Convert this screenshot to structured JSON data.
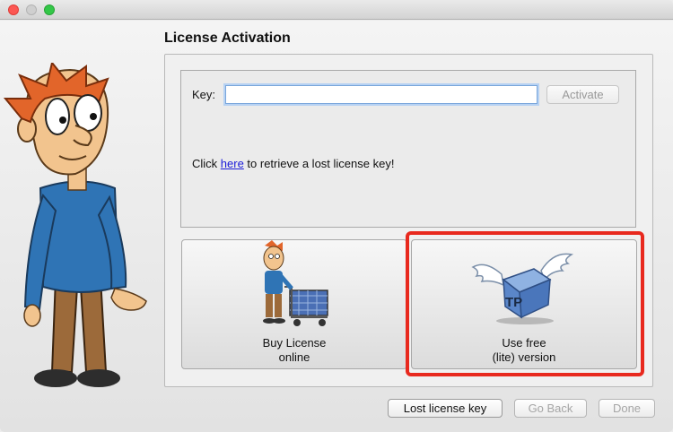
{
  "window": {
    "traffic_lights": [
      "close",
      "minimize",
      "maximize"
    ]
  },
  "dialog": {
    "title": "License Activation"
  },
  "key_section": {
    "label": "Key:",
    "value": "",
    "placeholder": "",
    "activate_label": "Activate",
    "retrieve_prefix": "Click ",
    "retrieve_link": "here",
    "retrieve_suffix": " to retrieve a lost license key!"
  },
  "options": {
    "buy": {
      "line1": "Buy License",
      "line2": "online",
      "icon": "shopping-cart-mascot-icon"
    },
    "free": {
      "line1": "Use free",
      "line2": "(lite) version",
      "icon": "winged-tp-cube-icon",
      "cube_text": "TP"
    }
  },
  "footer": {
    "lost_key_label": "Lost license key",
    "go_back_label": "Go Back",
    "done_label": "Done"
  },
  "colors": {
    "highlight": "#e8291e",
    "link": "#1a1ad8",
    "mascot_hair": "#e2652a",
    "mascot_shirt": "#2f74b5",
    "mascot_pants": "#9c6a3a"
  }
}
